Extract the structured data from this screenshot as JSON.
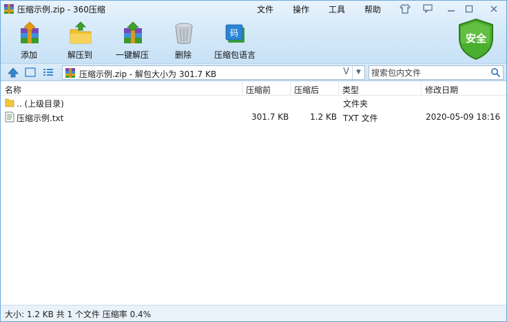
{
  "window": {
    "title": "压缩示例.zip - 360压缩",
    "menus": [
      "文件",
      "操作",
      "工具",
      "帮助"
    ],
    "controls": [
      "shirt-icon",
      "feedback-icon",
      "minimize-icon",
      "maximize-icon",
      "close-icon"
    ]
  },
  "toolbar": {
    "buttons": [
      {
        "label": "添加",
        "icon": "add-archive-icon"
      },
      {
        "label": "解压到",
        "icon": "extract-to-icon"
      },
      {
        "label": "一键解压",
        "icon": "one-click-extract-icon"
      },
      {
        "label": "删除",
        "icon": "delete-icon"
      },
      {
        "label": "压缩包语言",
        "icon": "archive-language-icon"
      }
    ],
    "security_badge": "安全"
  },
  "address": {
    "text": "压缩示例.zip - 解包大小为 301.7 KB",
    "verify_mark": "V",
    "search_placeholder": "搜索包内文件"
  },
  "columns": [
    "名称",
    "压缩前",
    "压缩后",
    "类型",
    "修改日期"
  ],
  "rows": [
    {
      "name": ".. (上级目录)",
      "before": "",
      "after": "",
      "type": "文件夹",
      "date": "",
      "icon": "folder-icon"
    },
    {
      "name": "压缩示例.txt",
      "before": "301.7 KB",
      "after": "1.2 KB",
      "type": "TXT 文件",
      "date": "2020-05-09 18:16",
      "icon": "text-file-icon"
    }
  ],
  "status": {
    "text": "大小: 1.2 KB 共 1 个文件 压缩率 0.4%"
  },
  "colors": {
    "accent": "#2d7fd0",
    "shield_green": "#3f9e2a"
  }
}
